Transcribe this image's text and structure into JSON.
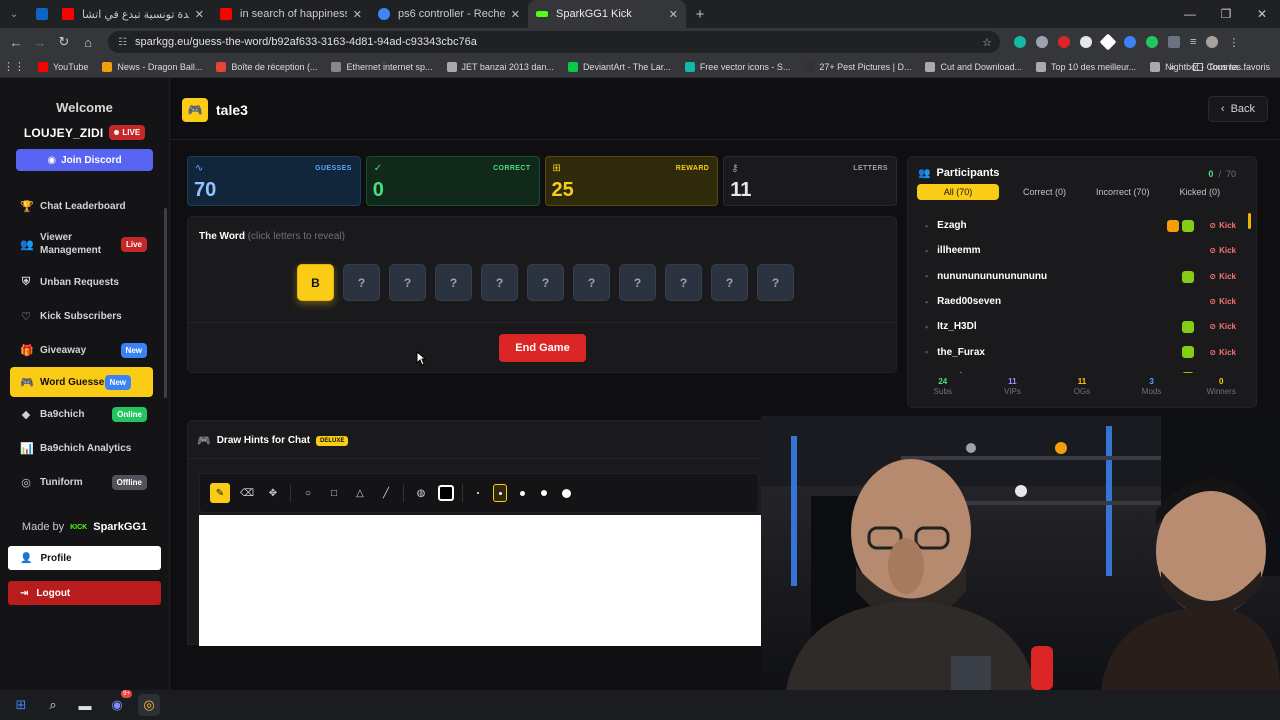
{
  "browser": {
    "tabs": [
      {
        "title": "دلندة سيدة تونسية تبدع في اتشا...",
        "fav_color": "#ff0000",
        "active": false
      },
      {
        "title": "in search of happiness - YouTube",
        "fav_color": "#ff0000",
        "active": false
      },
      {
        "title": "ps6 controller - Recherche Goo...",
        "fav_color": "#4285f4",
        "active": false
      },
      {
        "title": "SparkGG1 Kick",
        "fav_color": "#53fc18",
        "active": true
      }
    ],
    "url": "sparkgg.eu/guess-the-word/b92af633-3163-4d81-94ad-c93343cbc76a",
    "bookmarks": [
      {
        "label": "YouTube",
        "color": "#ff0000"
      },
      {
        "label": "News - Dragon Ball...",
        "color": "#f59e0b"
      },
      {
        "label": "Boîte de réception (...",
        "color": "#ea4335"
      },
      {
        "label": "Ethernet internet sp...",
        "color": "#888888"
      },
      {
        "label": "JET banzai 2013 dan...",
        "color": "#aaaaaa"
      },
      {
        "label": "DeviantArt - The Lar...",
        "color": "#05cc47"
      },
      {
        "label": "Free vector icons - S...",
        "color": "#14b8a6"
      },
      {
        "label": "27+ Pest Pictures | D...",
        "color": "#333333"
      },
      {
        "label": "Cut and Download...",
        "color": "#aaaaaa"
      },
      {
        "label": "Top 10 des meilleur...",
        "color": "#aaaaaa"
      },
      {
        "label": "Nightbot - Comma...",
        "color": "#aaaaaa"
      }
    ],
    "bookmarks_right": "Tous les favoris"
  },
  "sidebar": {
    "welcome": "Welcome",
    "username": "LOUJEY_ZIDI",
    "live_label": "LIVE",
    "discord_label": "Join Discord",
    "items": [
      {
        "label": "Chat Leaderboard",
        "icon": "trophy-icon",
        "glyph": "🏆",
        "badge": ""
      },
      {
        "label": "Viewer Management",
        "icon": "users-icon",
        "glyph": "👥",
        "badge": "Live",
        "badge_color": "red"
      },
      {
        "label": "Unban Requests",
        "icon": "shield-check-icon",
        "glyph": "⛨",
        "badge": ""
      },
      {
        "label": "Kick Subscribers",
        "icon": "heart-icon",
        "glyph": "♡",
        "badge": ""
      },
      {
        "label": "Giveaway",
        "icon": "gift-icon",
        "glyph": "🎁",
        "badge": "New",
        "badge_color": "blue"
      },
      {
        "label": "Word Guesser",
        "icon": "gamepad-icon",
        "glyph": "🎮",
        "badge": "New",
        "badge_color": "blue",
        "active": true
      },
      {
        "label": "Ba9chich",
        "icon": "ba9chich-logo-icon",
        "glyph": "◆",
        "badge": "Online",
        "badge_color": "green"
      },
      {
        "label": "Ba9chich Analytics",
        "icon": "chart-icon",
        "glyph": "📊",
        "badge": ""
      },
      {
        "label": "Tuniform",
        "icon": "tuniform-logo-icon",
        "glyph": "◎",
        "badge": "Offline",
        "badge_color": "gray"
      }
    ],
    "made_by": "Made by",
    "made_by_name": "SparkGG1",
    "made_by_tag": "KICK",
    "profile_label": "Profile",
    "logout_label": "Logout"
  },
  "header": {
    "title": "tale3",
    "back_label": "Back"
  },
  "stats": [
    {
      "label": "GUESSES",
      "value": "70",
      "theme": "blue",
      "icon": "activity-icon",
      "glyph": "∿"
    },
    {
      "label": "CORRECT",
      "value": "0",
      "theme": "green",
      "icon": "check-circle-icon",
      "glyph": "✓"
    },
    {
      "label": "REWARD",
      "value": "25",
      "theme": "gold",
      "icon": "gift-icon",
      "glyph": "⊞"
    },
    {
      "label": "LETTERS",
      "value": "11",
      "theme": "dark",
      "icon": "key-icon",
      "glyph": "⚷"
    }
  ],
  "word": {
    "heading": "The Word",
    "hint": "(click letters to reveal)",
    "letters": [
      "B",
      "?",
      "?",
      "?",
      "?",
      "?",
      "?",
      "?",
      "?",
      "?",
      "?"
    ],
    "revealed_index": 0,
    "end_game_label": "End Game"
  },
  "participants": {
    "title": "Participants",
    "correct_count": "0",
    "separator": "/",
    "total": "70",
    "tabs": [
      "All (70)",
      "Correct (0)",
      "Incorrect (70)",
      "Kicked (0)"
    ],
    "kick_label": "Kick",
    "list": [
      {
        "name": "Ezagh",
        "badges": [
          "orange",
          "green"
        ]
      },
      {
        "name": "illheemm",
        "badges": []
      },
      {
        "name": "nununununununununu",
        "badges": [
          "green"
        ]
      },
      {
        "name": "Raed00seven",
        "badges": []
      },
      {
        "name": "Itz_H3Dl",
        "badges": [
          "green"
        ]
      },
      {
        "name": "the_Furax",
        "badges": [
          "green"
        ]
      },
      {
        "name": "yassine",
        "badges": [
          "green"
        ]
      }
    ],
    "footer": [
      {
        "value": "24",
        "label": "Subs",
        "color": "#4ade80"
      },
      {
        "value": "11",
        "label": "VIPs",
        "color": "#a78bfa"
      },
      {
        "value": "11",
        "label": "OGs",
        "color": "#facc15"
      },
      {
        "value": "3",
        "label": "Mods",
        "color": "#60a5fa"
      },
      {
        "value": "0",
        "label": "Winners",
        "color": "#facc15"
      }
    ]
  },
  "hints": {
    "title": "Draw Hints for Chat",
    "tier": "DELUXE"
  },
  "taskbar": {
    "discord_badge": "9+"
  }
}
